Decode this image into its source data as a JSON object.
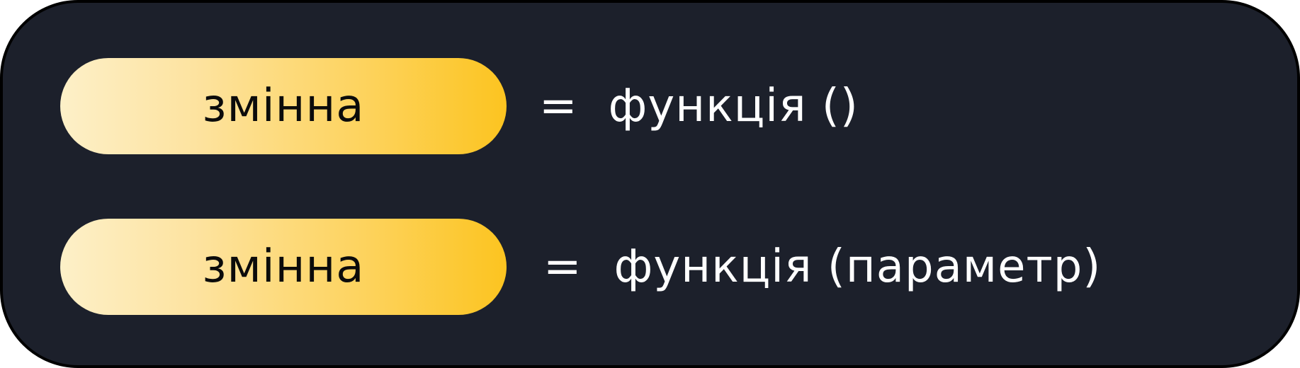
{
  "rows": [
    {
      "variable": "змінна",
      "operator": "=",
      "expression": "функція ()"
    },
    {
      "variable": "змінна",
      "operator": "=",
      "expression": "функція (параметр)"
    }
  ],
  "colors": {
    "background": "#1c202b",
    "border": "#000000",
    "pill_gradient_start": "#fdf0c8",
    "pill_gradient_end": "#fcc420",
    "pill_text": "#0b0b0b",
    "text": "#ffffff"
  }
}
